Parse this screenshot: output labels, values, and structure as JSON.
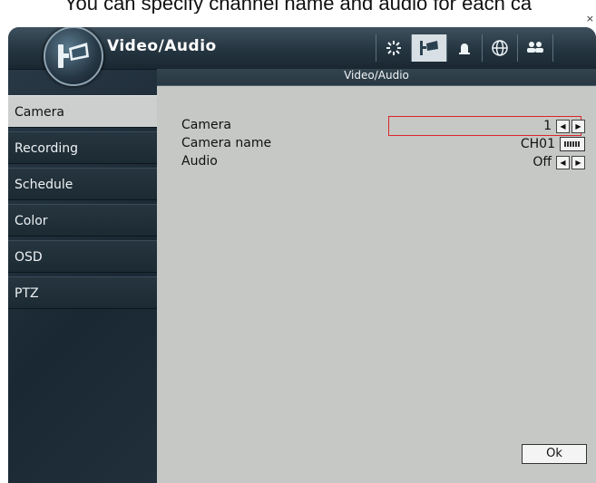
{
  "caption": "You can specify channel name and audio for each ca",
  "close_glyph": "×",
  "window": {
    "title": "Video/Audio"
  },
  "toolbar": {
    "icons": [
      "settings-icon",
      "camera-icon",
      "alarm-icon",
      "network-icon",
      "users-icon"
    ],
    "active": "camera-icon"
  },
  "panel": {
    "title": "Video/Audio"
  },
  "sidebar": {
    "items": [
      {
        "label": "Camera",
        "selected": true
      },
      {
        "label": "Recording",
        "selected": false
      },
      {
        "label": "Schedule",
        "selected": false
      },
      {
        "label": "Color",
        "selected": false
      },
      {
        "label": "OSD",
        "selected": false
      },
      {
        "label": "PTZ",
        "selected": false
      }
    ]
  },
  "settings": {
    "camera": {
      "label": "Camera",
      "value": "1"
    },
    "camera_name": {
      "label": "Camera name",
      "value": "CH01"
    },
    "audio": {
      "label": "Audio",
      "value": "Off"
    }
  },
  "buttons": {
    "ok": "Ok"
  },
  "colors": {
    "highlight": "#d9262a",
    "panel": "#c6c8c5",
    "frame": "#1f2d37"
  }
}
